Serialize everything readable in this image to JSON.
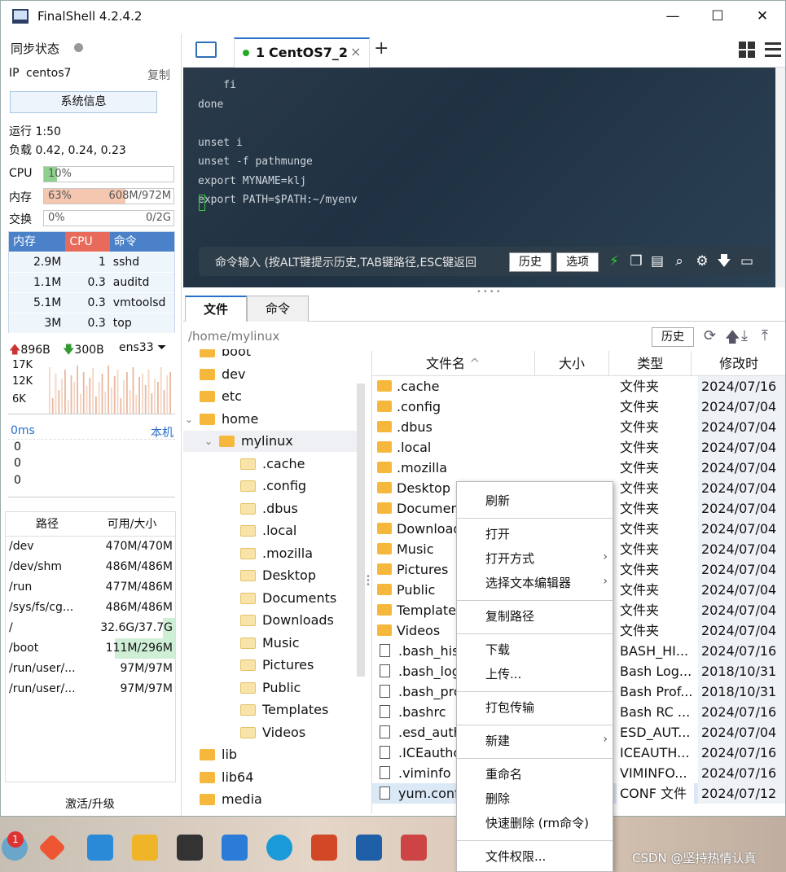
{
  "window": {
    "title": "FinalShell 4.2.4.2",
    "minimize": "—",
    "maximize": "☐",
    "close": "✕"
  },
  "status": {
    "sync_label": "同步状态",
    "ip_label": "IP",
    "ip_value": "centos7",
    "copy": "复制",
    "sysinfo_btn": "系统信息",
    "uptime": "运行 1:50",
    "load": "负载 0.42, 0.24, 0.23"
  },
  "meters": [
    {
      "label": "CPU",
      "pct_text": "10%",
      "right": "",
      "fill": 0.1,
      "color": "#8fd08f"
    },
    {
      "label": "内存",
      "pct_text": "63%",
      "right": "608M/972M",
      "fill": 0.63,
      "color": "#f5c7b0"
    },
    {
      "label": "交换",
      "pct_text": "0%",
      "right": "0/2G",
      "fill": 0,
      "color": "#ccc"
    }
  ],
  "processes": {
    "headers": [
      "内存",
      "CPU",
      "命令"
    ],
    "rows": [
      [
        "2.9M",
        "1",
        "sshd"
      ],
      [
        "1.1M",
        "0.3",
        "auditd"
      ],
      [
        "5.1M",
        "0.3",
        "vmtoolsd"
      ],
      [
        "3M",
        "0.3",
        "top"
      ]
    ]
  },
  "net": {
    "up": "896B",
    "down": "300B",
    "iface": "ens33",
    "ticks": [
      "17K",
      "12K",
      "6K"
    ]
  },
  "ping": {
    "latency": "0ms",
    "host": "本机",
    "values": [
      "0",
      "0",
      "0"
    ]
  },
  "disks": {
    "headers": [
      "路径",
      "可用/大小"
    ],
    "rows": [
      [
        "/dev",
        "470M/470M"
      ],
      [
        "/dev/shm",
        "486M/486M"
      ],
      [
        "/run",
        "477M/486M"
      ],
      [
        "/sys/fs/cg...",
        "486M/486M"
      ],
      [
        "/",
        "32.6G/37.7G"
      ],
      [
        "/boot",
        "111M/296M"
      ],
      [
        "/run/user/...",
        "97M/97M"
      ],
      [
        "/run/user/...",
        "97M/97M"
      ]
    ]
  },
  "activate": "激活/升级",
  "tab": {
    "index": "1",
    "name": "CentOS7_2",
    "close": "×",
    "add": "+"
  },
  "terminal": {
    "lines": [
      "    fi",
      "done",
      "",
      "unset i",
      "unset -f pathmunge",
      "export MYNAME=klj",
      "export PATH=$PATH:~/myenv"
    ]
  },
  "cmdbar": {
    "placeholder": "命令输入 (按ALT键提示历史,TAB键路径,ESC键返回",
    "history": "历史",
    "options": "选项"
  },
  "lower_tabs": [
    "文件",
    "命令"
  ],
  "path": {
    "value": "/home/mylinux",
    "history": "历史"
  },
  "tree": [
    {
      "name": "boot",
      "level": 0,
      "open": false
    },
    {
      "name": "dev",
      "level": 0,
      "open": false
    },
    {
      "name": "etc",
      "level": 0,
      "open": false
    },
    {
      "name": "home",
      "level": 0,
      "open": true
    },
    {
      "name": "mylinux",
      "level": 1,
      "open": true
    },
    {
      "name": ".cache",
      "level": 2,
      "open": false
    },
    {
      "name": ".config",
      "level": 2,
      "open": false
    },
    {
      "name": ".dbus",
      "level": 2,
      "open": false
    },
    {
      "name": ".local",
      "level": 2,
      "open": false
    },
    {
      "name": ".mozilla",
      "level": 2,
      "open": false
    },
    {
      "name": "Desktop",
      "level": 2,
      "open": false
    },
    {
      "name": "Documents",
      "level": 2,
      "open": false
    },
    {
      "name": "Downloads",
      "level": 2,
      "open": false
    },
    {
      "name": "Music",
      "level": 2,
      "open": false
    },
    {
      "name": "Pictures",
      "level": 2,
      "open": false
    },
    {
      "name": "Public",
      "level": 2,
      "open": false
    },
    {
      "name": "Templates",
      "level": 2,
      "open": false
    },
    {
      "name": "Videos",
      "level": 2,
      "open": false
    },
    {
      "name": "lib",
      "level": 0,
      "open": false
    },
    {
      "name": "lib64",
      "level": 0,
      "open": false
    },
    {
      "name": "media",
      "level": 0,
      "open": false
    }
  ],
  "files": {
    "headers": [
      "文件名",
      "大小",
      "类型",
      "修改时"
    ],
    "rows": [
      {
        "name": ".cache",
        "type": "文件夹",
        "date": "2024/07/16",
        "dir": true
      },
      {
        "name": ".config",
        "type": "文件夹",
        "date": "2024/07/04",
        "dir": true
      },
      {
        "name": ".dbus",
        "type": "文件夹",
        "date": "2024/07/04",
        "dir": true
      },
      {
        "name": ".local",
        "type": "文件夹",
        "date": "2024/07/04",
        "dir": true
      },
      {
        "name": ".mozilla",
        "type": "文件夹",
        "date": "2024/07/04",
        "dir": true
      },
      {
        "name": "Desktop",
        "type": "文件夹",
        "date": "2024/07/04",
        "dir": true
      },
      {
        "name": "Documen",
        "type": "文件夹",
        "date": "2024/07/04",
        "dir": true
      },
      {
        "name": "Download",
        "type": "文件夹",
        "date": "2024/07/04",
        "dir": true
      },
      {
        "name": "Music",
        "type": "文件夹",
        "date": "2024/07/04",
        "dir": true
      },
      {
        "name": "Pictures",
        "type": "文件夹",
        "date": "2024/07/04",
        "dir": true
      },
      {
        "name": "Public",
        "type": "文件夹",
        "date": "2024/07/04",
        "dir": true
      },
      {
        "name": "Templates",
        "type": "文件夹",
        "date": "2024/07/04",
        "dir": true
      },
      {
        "name": "Videos",
        "type": "文件夹",
        "date": "2024/07/04",
        "dir": true
      },
      {
        "name": ".bash_hist",
        "type": "BASH_HI...",
        "date": "2024/07/16",
        "dir": false
      },
      {
        "name": ".bash_logo",
        "type": "Bash Log...",
        "date": "2018/10/31",
        "dir": false
      },
      {
        "name": ".bash_pro",
        "type": "Bash Prof...",
        "date": "2018/10/31",
        "dir": false
      },
      {
        "name": ".bashrc",
        "type": "Bash RC ...",
        "date": "2024/07/16",
        "dir": false
      },
      {
        "name": ".esd_auth",
        "type": "ESD_AUT...",
        "date": "2024/07/04",
        "dir": false
      },
      {
        "name": ".ICEautho",
        "type": "ICEAUTH...",
        "date": "2024/07/16",
        "dir": false
      },
      {
        "name": ".viminfo",
        "type": "VIMINFO...",
        "date": "2024/07/16",
        "dir": false
      },
      {
        "name": "yum.conf",
        "type": "CONF 文件",
        "date": "2024/07/12",
        "dir": false
      }
    ]
  },
  "context_menu": [
    {
      "label": "刷新",
      "sub": false
    },
    {
      "sep": true
    },
    {
      "label": "打开",
      "sub": false
    },
    {
      "label": "打开方式",
      "sub": true
    },
    {
      "label": "选择文本编辑器",
      "sub": true
    },
    {
      "sep": true
    },
    {
      "label": "复制路径",
      "sub": false
    },
    {
      "sep": true
    },
    {
      "label": "下载",
      "sub": false
    },
    {
      "label": "上传...",
      "sub": false
    },
    {
      "sep": true
    },
    {
      "label": "打包传输",
      "sub": false
    },
    {
      "sep": true
    },
    {
      "label": "新建",
      "sub": true
    },
    {
      "sep": true
    },
    {
      "label": "重命名",
      "sub": false
    },
    {
      "label": "删除",
      "sub": false
    },
    {
      "label": "快速删除 (rm命令)",
      "sub": false
    },
    {
      "sep": true
    },
    {
      "label": "文件权限...",
      "sub": false
    }
  ],
  "taskbar": {
    "badge": "1",
    "watermark": "CSDN @坚持热情认真"
  }
}
